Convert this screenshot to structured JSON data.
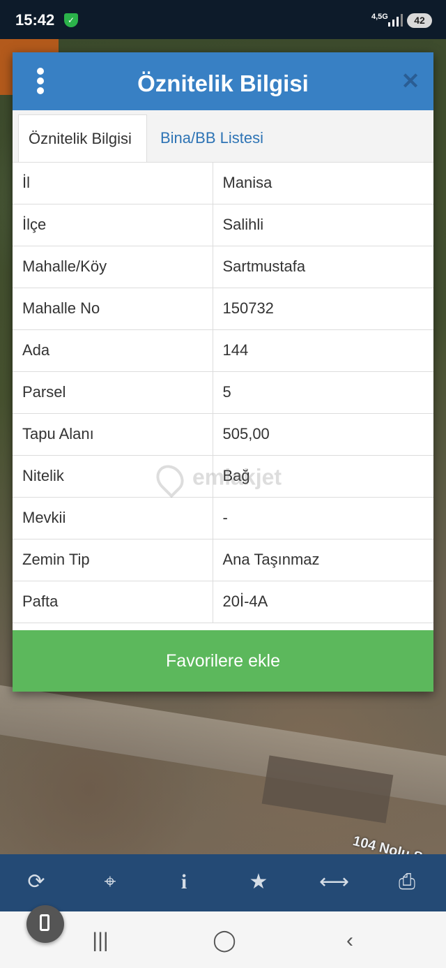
{
  "status_bar": {
    "time": "15:42",
    "network": "4,5G",
    "battery": "42"
  },
  "map": {
    "street_label": "104 Nolu S"
  },
  "dialog": {
    "title": "Öznitelik Bilgisi",
    "tabs": [
      {
        "label": "Öznitelik Bilgisi",
        "active": true
      },
      {
        "label": "Bina/BB Listesi",
        "active": false
      }
    ],
    "rows": [
      {
        "key": "İl",
        "value": "Manisa"
      },
      {
        "key": "İlçe",
        "value": "Salihli"
      },
      {
        "key": "Mahalle/Köy",
        "value": "Sartmustafa"
      },
      {
        "key": "Mahalle No",
        "value": "150732"
      },
      {
        "key": "Ada",
        "value": "144"
      },
      {
        "key": "Parsel",
        "value": "5"
      },
      {
        "key": "Tapu Alanı",
        "value": "505,00"
      },
      {
        "key": "Nitelik",
        "value": "Bağ"
      },
      {
        "key": "Mevkii",
        "value": "-"
      },
      {
        "key": "Zemin Tip",
        "value": "Ana Taşınmaz"
      },
      {
        "key": "Pafta",
        "value": "20İ-4A"
      }
    ],
    "favorite_button": "Favorilere ekle",
    "watermark": "emlakjet"
  },
  "colors": {
    "header": "#3880c4",
    "button": "#5cb85c",
    "toolbar": "#244a75"
  },
  "toolbar_icons": [
    "refresh-icon",
    "crosshair-icon",
    "info-icon",
    "star-icon",
    "measure-icon",
    "print-icon"
  ]
}
